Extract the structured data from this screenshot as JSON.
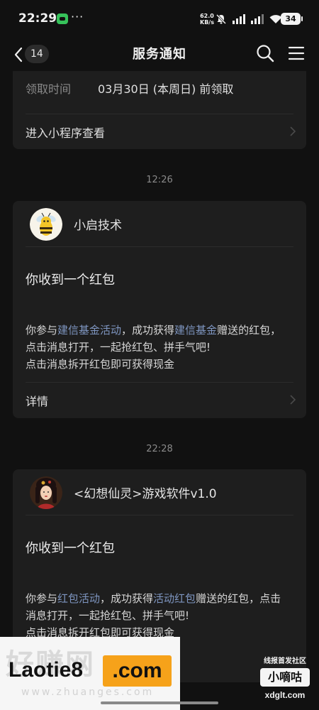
{
  "status_bar": {
    "time": "22:29",
    "more": "···",
    "net_speed_value": "62.0",
    "net_speed_unit": "KB/s",
    "battery": "34"
  },
  "nav": {
    "unread_count": "14",
    "title": "服务通知"
  },
  "top_card": {
    "row_label": "领取时间",
    "row_value": "03月30日 (本周日) 前领取",
    "link_label": "进入小程序查看"
  },
  "messages": [
    {
      "time": "12:26",
      "sender": "小启技术",
      "title": "你收到一个红包",
      "body_line1_a": "你参与",
      "body_line1_hl1": "建信基金活动",
      "body_line1_b": "，成功获得",
      "body_line1_hl2": "建信基金",
      "body_line1_c": "赠送的红包，",
      "body_line2": "点击消息打开，一起抢红包、拼手气吧!",
      "body_line3": "点击消息拆开红包即可获得现金",
      "link_label": "详情"
    },
    {
      "time": "22:28",
      "sender": "<幻想仙灵>游戏软件v1.0",
      "title": "你收到一个红包",
      "body_line1_a": "你参与",
      "body_line1_hl1": "红包活动",
      "body_line1_b": "，成功获得",
      "body_line1_hl2": "活动红包",
      "body_line1_c": "赠送的红包，点击",
      "body_line2": "消息打开，一起抢红包、拼手气吧!",
      "body_line3": "点击消息拆开红包即可获得现金"
    }
  ],
  "watermark": {
    "ghost_text": "好赚网",
    "ghost_url": "www.zhuanges.com",
    "brand_a": "Laotie8",
    "brand_b": ".com",
    "right_top": "线报首发社区",
    "right_box": "小嘀咕",
    "right_url": "xdglt.com"
  },
  "colors": {
    "background": "#111111",
    "card": "#1e1e1e",
    "link_highlight": "#7e95c0",
    "muted_text": "#8a8a8a",
    "accent_orange": "#f6a21a"
  }
}
